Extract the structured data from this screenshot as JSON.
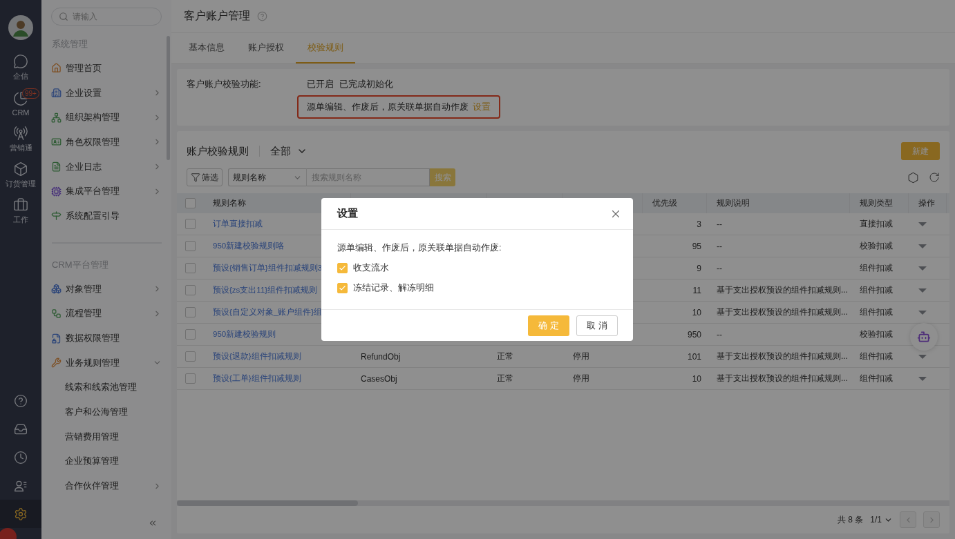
{
  "rail": {
    "items": [
      {
        "label": "企信",
        "selected": false
      },
      {
        "label": "CRM",
        "selected": false,
        "badge": "99+"
      },
      {
        "label": "营销通",
        "selected": false
      },
      {
        "label": "订货管理",
        "selected": false
      },
      {
        "label": "工作",
        "selected": false
      }
    ],
    "bottom_icons": [
      {
        "selected": false
      },
      {
        "selected": false
      },
      {
        "selected": false
      },
      {
        "selected": false
      },
      {
        "selected": true
      }
    ]
  },
  "sidebar": {
    "search": {
      "placeholder": "请输入"
    },
    "sections": [
      {
        "title": "系统管理",
        "items": [
          {
            "label": "管理首页",
            "kind": "link"
          },
          {
            "label": "企业设置",
            "kind": "group",
            "expanded": false
          },
          {
            "label": "组织架构管理",
            "kind": "group",
            "expanded": false
          },
          {
            "label": "角色权限管理",
            "kind": "group",
            "expanded": false
          },
          {
            "label": "企业日志",
            "kind": "group",
            "expanded": false
          },
          {
            "label": "集成平台管理",
            "kind": "group",
            "expanded": false
          },
          {
            "label": "系统配置引导",
            "kind": "link"
          }
        ]
      },
      {
        "title": "CRM平台管理",
        "items": [
          {
            "label": "对象管理",
            "kind": "group",
            "expanded": false
          },
          {
            "label": "流程管理",
            "kind": "group",
            "expanded": false
          },
          {
            "label": "数据权限管理",
            "kind": "link"
          },
          {
            "label": "业务规则管理",
            "kind": "group",
            "expanded": true,
            "children": [
              {
                "label": "线索和线索池管理",
                "kind": "link"
              },
              {
                "label": "客户和公海管理",
                "kind": "link"
              },
              {
                "label": "营销费用管理",
                "kind": "link"
              },
              {
                "label": "企业预算管理",
                "kind": "link"
              },
              {
                "label": "合作伙伴管理",
                "kind": "group",
                "expanded": false
              }
            ]
          }
        ]
      }
    ]
  },
  "page": {
    "title": "客户账户管理",
    "tabs": [
      {
        "label": "基本信息",
        "selected": false
      },
      {
        "label": "账户授权",
        "selected": false
      },
      {
        "label": "校验规则",
        "selected": true
      }
    ]
  },
  "check_info": {
    "label": "客户账户校验功能:",
    "status": [
      "已开启",
      "已完成初始化"
    ],
    "setting": {
      "text": "源单编辑、作废后，原关联单据自动作废",
      "link": "设置",
      "highlighted": true
    }
  },
  "rules": {
    "title": "账户校验规则",
    "scope": "全部",
    "new_button": "新建",
    "filter_button": "筛选",
    "field_select": "规则名称",
    "search": {
      "placeholder": "搜索规则名称"
    },
    "search_button": "搜索",
    "table": {
      "all_selected": false,
      "columns": [
        "规则名称",
        null,
        null,
        null,
        "优先级",
        "规则说明",
        "规则类型",
        "操作"
      ],
      "rows": [
        {
          "selected": false,
          "cells": [
            "订单直接扣减",
            null,
            null,
            null,
            "3",
            "--",
            "直接扣减"
          ]
        },
        {
          "selected": false,
          "cells": [
            "950新建校验规则咯",
            null,
            null,
            null,
            "95",
            "--",
            "校验扣减"
          ]
        },
        {
          "selected": false,
          "cells": [
            "预设{销售订单}组件扣减规则3",
            null,
            null,
            null,
            "9",
            "--",
            "组件扣减"
          ]
        },
        {
          "selected": false,
          "cells": [
            "预设{zs支出11}组件扣减规则",
            null,
            null,
            null,
            "11",
            "基于支出授权预设的组件扣减规则...",
            "组件扣减"
          ]
        },
        {
          "selected": false,
          "cells": [
            "预设{自定义对象_账户组件}组",
            null,
            null,
            null,
            "10",
            "基于支出授权预设的组件扣减规则...",
            "组件扣减"
          ]
        },
        {
          "selected": false,
          "cells": [
            "950新建校验规则",
            null,
            null,
            null,
            "950",
            "--",
            "校验扣减"
          ]
        },
        {
          "selected": false,
          "cells": [
            "预设{退款}组件扣减规则",
            "RefundObj",
            "正常",
            "停用",
            "101",
            "基于支出授权预设的组件扣减规则...",
            "组件扣减"
          ]
        },
        {
          "selected": false,
          "cells": [
            "预设{工单}组件扣减规则",
            "CasesObj",
            "正常",
            "停用",
            "10",
            "基于支出授权预设的组件扣减规则...",
            "组件扣减"
          ]
        }
      ]
    },
    "pagination": {
      "total": "共 8 条",
      "page": "1/1"
    }
  },
  "dialog": {
    "title": "设置",
    "prompt": "源单编辑、作废后，原关联单据自动作废:",
    "options": [
      {
        "label": "收支流水",
        "checked": true
      },
      {
        "label": "冻结记录、解冻明细",
        "checked": true
      }
    ],
    "ok": "确 定",
    "cancel": "取 消"
  }
}
